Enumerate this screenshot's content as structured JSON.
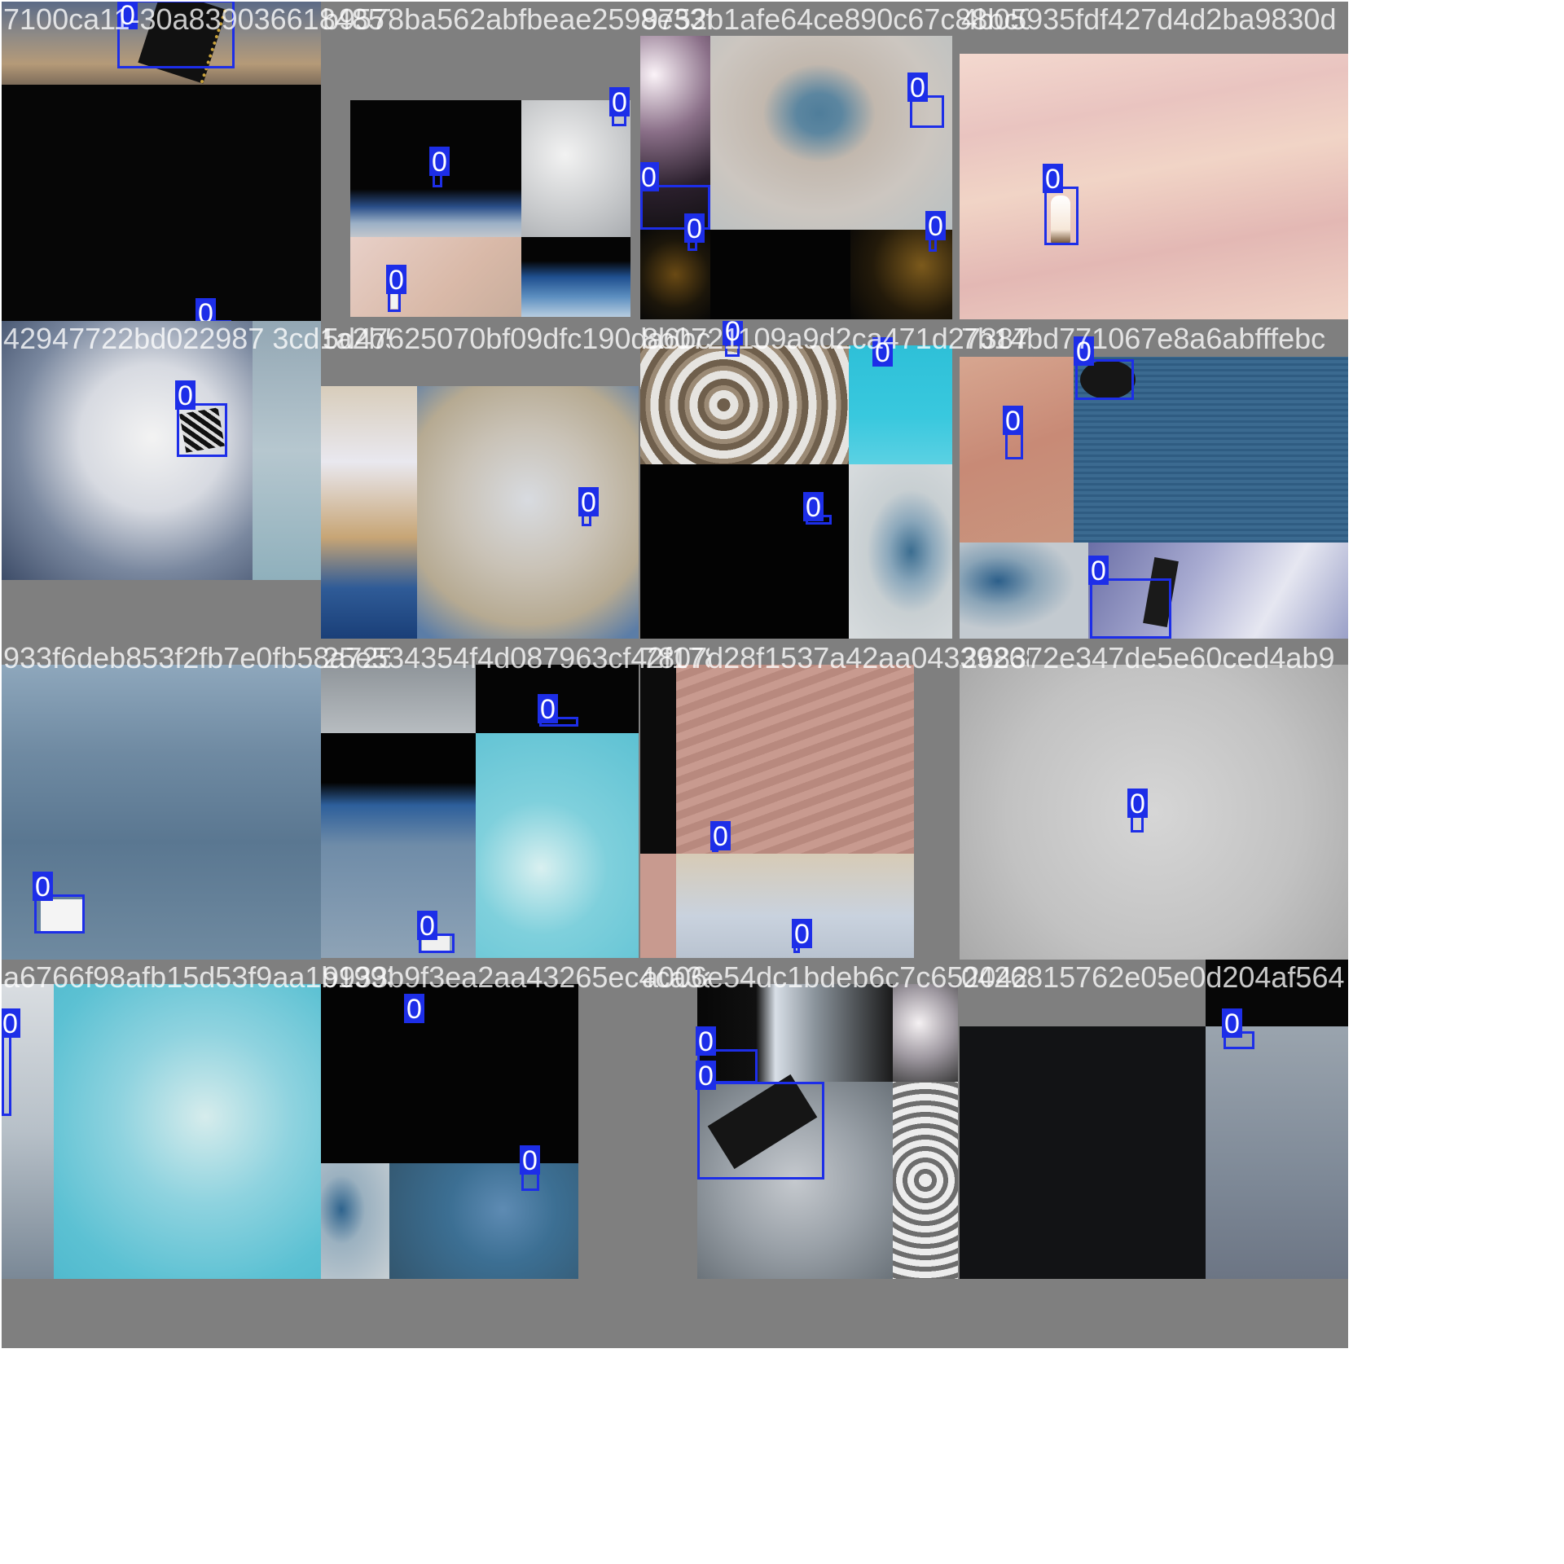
{
  "grid": {
    "tiles": [
      {
        "filename": "7100ca11-30a839036618485789e5..fbe",
        "label": "0"
      },
      {
        "filename": "b9578ba562abfbeae2598e33ffa9752b1afe64ce",
        "label": "0"
      },
      {
        "filename": "9752b1afe64ce890c67c88bc04b05935fdf427d4d2ba9830d",
        "label": "0"
      },
      {
        "filename": "4b05935fdf427d4d2ba9830d",
        "label": "0"
      },
      {
        "filename": "42947722bd022987 3cd1a2b5ed625070.png",
        "label": "0"
      },
      {
        "filename": "5d47625070bf09dfc190da6bc8b0721109a9d2ca471d273",
        "label": "0"
      },
      {
        "filename": "8b0721109a9d2ca471d27387b14bd771067e8a6abfffebc",
        "label": "0"
      },
      {
        "filename": "7b14bd771067e8a6abfffebc",
        "label": "0"
      },
      {
        "filename": "933f6deb853f2fb7e0fb58a725e534354f4d087963cf42f1",
        "label": "0"
      },
      {
        "filename": "25e534354f4d087963cf42f17807d28f1537a42aa043392",
        "label": "0"
      },
      {
        "filename": "7807d28f1537a42aa04339268372e347de5e60ced4ab9",
        "label": "0"
      },
      {
        "filename": "268372e347de5e60ced4ab9",
        "label": "0"
      },
      {
        "filename": "a6766f98afb15d53f9aa1b19933b9f3ea2aa43265ec4ca3",
        "label": "0"
      },
      {
        "filename": "9933b9f3ea2aa43265ec4ca3a006e54dc1bdeb6c7c652",
        "label": "0"
      },
      {
        "filename": "a006e54dc1bdeb6c7c6520426815762e05e0d204af564",
        "label": "0"
      },
      {
        "filename": "0426815762e05e0d204af564",
        "label": "0"
      }
    ]
  },
  "colors": {
    "box": "#1d2ee8",
    "pad": "#7f7f7f",
    "text": "#ffffff"
  }
}
